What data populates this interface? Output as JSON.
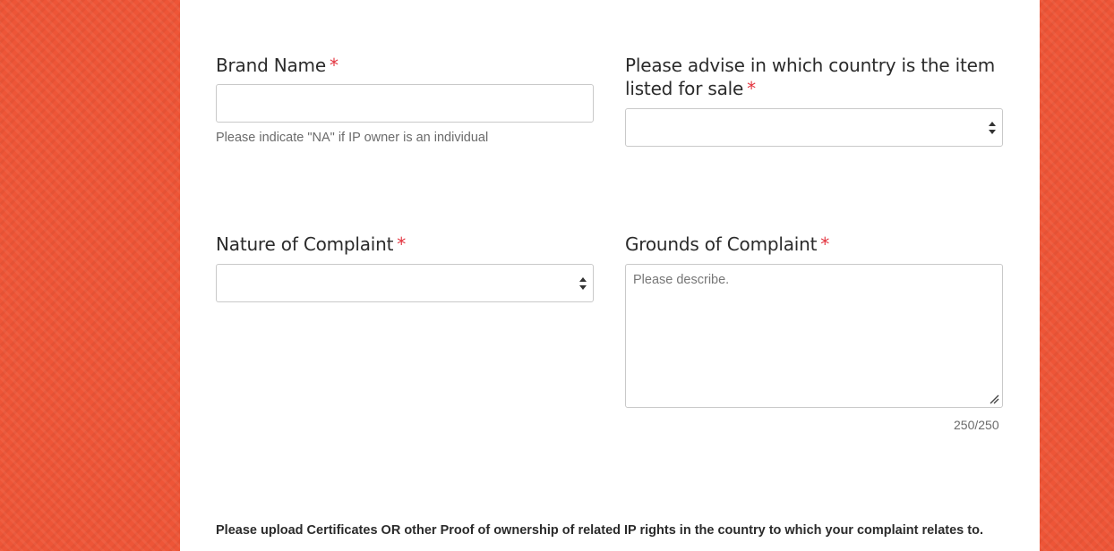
{
  "form": {
    "required_marker": "*",
    "brand_name": {
      "label": "Brand Name",
      "value": "",
      "hint": "Please indicate \"NA\" if IP owner is an individual"
    },
    "country": {
      "label": "Please advise in which country is the item listed for sale",
      "selected_value": ""
    },
    "nature_of_complaint": {
      "label": "Nature of Complaint",
      "selected_value": ""
    },
    "grounds_of_complaint": {
      "label": "Grounds of Complaint",
      "placeholder": "Please describe.",
      "counter": "250/250"
    },
    "upload_note": "Please upload Certificates OR other Proof of ownership of related IP rights in the country to which your complaint relates to."
  },
  "colors": {
    "background": "#ee5537",
    "required": "#e3343f",
    "panel": "#ffffff"
  },
  "icons": {
    "select_arrows": "select-arrows-icon",
    "resize": "resize-grip-icon"
  }
}
